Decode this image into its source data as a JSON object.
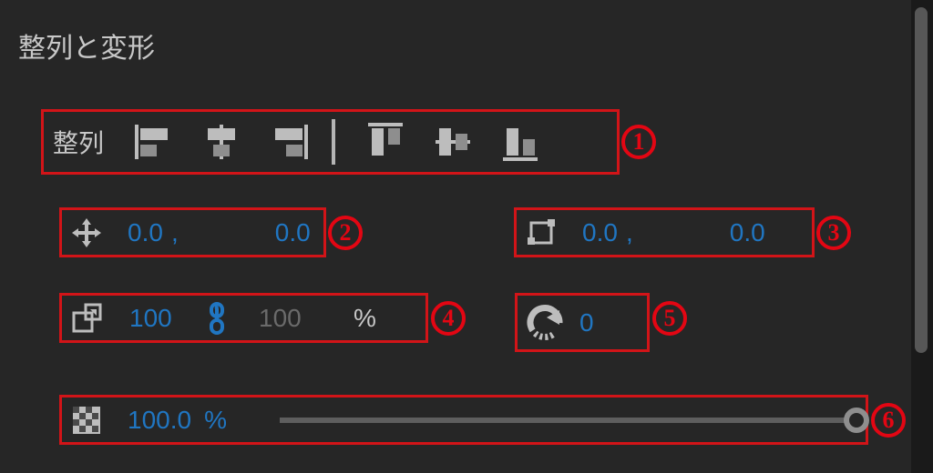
{
  "panel": {
    "title": "整列と変形",
    "align": {
      "label": "整列",
      "buttons": [
        "align-left",
        "align-center-h",
        "align-right",
        "align-top",
        "align-middle-v",
        "align-bottom"
      ]
    },
    "position": {
      "x": "0.0",
      "y": "0.0"
    },
    "anchor": {
      "x": "0.0",
      "y": "0.0"
    },
    "scale": {
      "x": "100",
      "y": "100",
      "linked": true,
      "unit": "%"
    },
    "rotation": {
      "value": "0"
    },
    "opacity": {
      "value": "100.0",
      "unit": "%",
      "slider_pct": 100
    }
  },
  "callouts": {
    "1": "1",
    "2": "2",
    "3": "3",
    "4": "4",
    "5": "5",
    "6": "6"
  },
  "colors": {
    "accent": "#2076c2",
    "callout": "#e30613",
    "icon": "#bdbdbd"
  }
}
